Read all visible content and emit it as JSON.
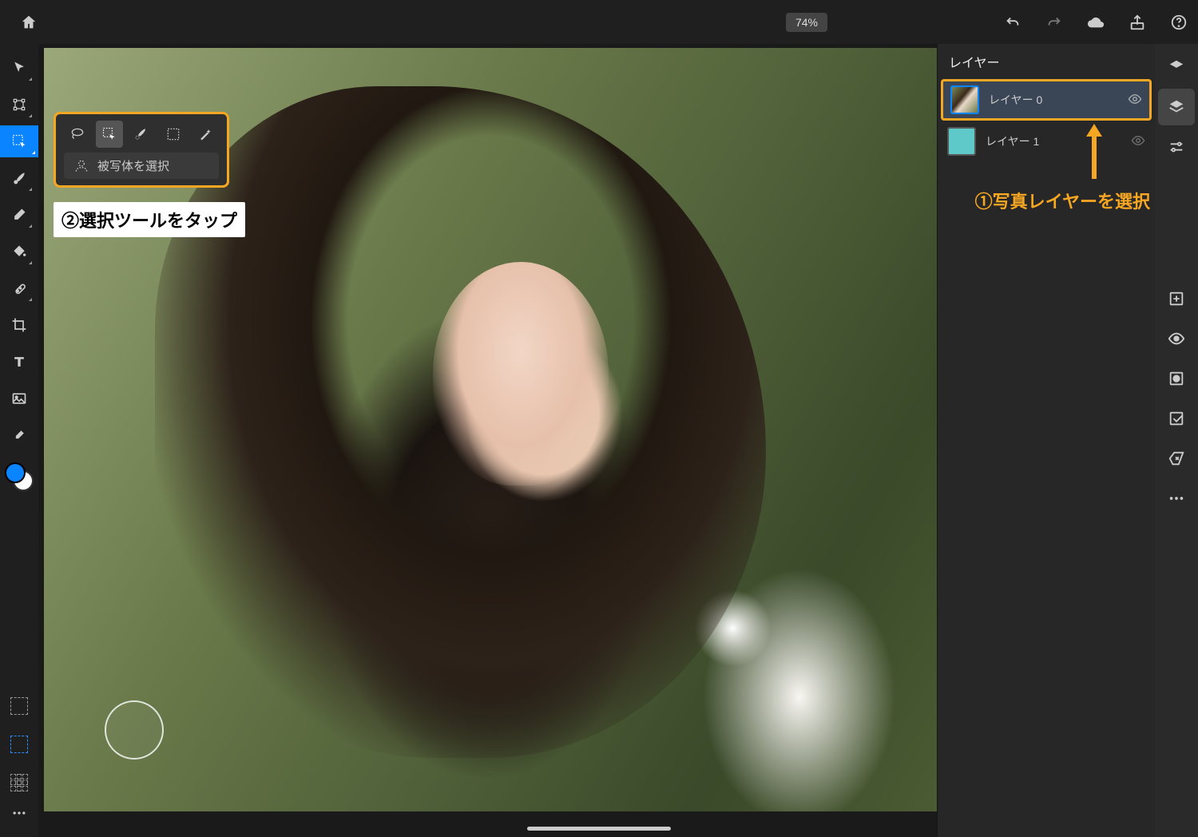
{
  "topbar": {
    "zoom": "74%"
  },
  "flyout": {
    "subject_label": "被写体を選択"
  },
  "annotations": {
    "step1": "①写真レイヤーを選択",
    "step2": "②選択ツールをタップ"
  },
  "layers": {
    "title": "レイヤー",
    "items": [
      {
        "name": "レイヤー 0",
        "selected": true
      },
      {
        "name": "レイヤー 1",
        "selected": false
      }
    ]
  },
  "colors": {
    "accent": "#0a84ff",
    "highlight": "#f5a623",
    "panel": "#272727"
  }
}
